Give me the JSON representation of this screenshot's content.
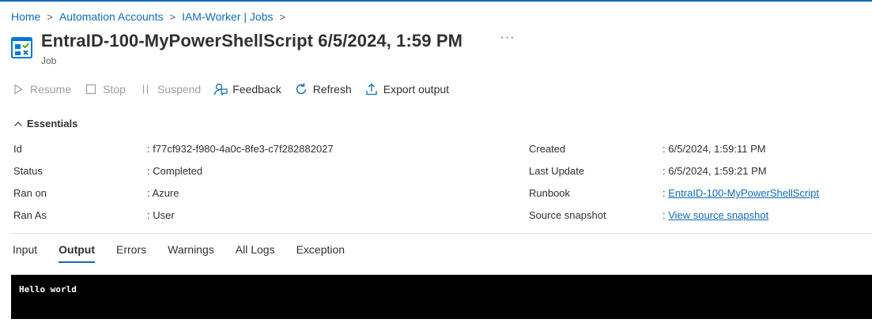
{
  "breadcrumb": {
    "items": [
      "Home",
      "Automation Accounts",
      "IAM-Worker | Jobs"
    ],
    "separator": ">"
  },
  "header": {
    "title": "EntraID-100-MyPowerShellScript 6/5/2024, 1:59 PM",
    "subtitle": "Job",
    "more": "···",
    "icon": "job-icon"
  },
  "toolbar": {
    "resume": "Resume",
    "stop": "Stop",
    "suspend": "Suspend",
    "feedback": "Feedback",
    "refresh": "Refresh",
    "export": "Export output"
  },
  "essentials": {
    "title": "Essentials",
    "colon": ":",
    "left": [
      {
        "label": "Id",
        "value": "f77cf932-f980-4a0c-8fe3-c7f282882027"
      },
      {
        "label": "Status",
        "value": "Completed"
      },
      {
        "label": "Ran on",
        "value": "Azure"
      },
      {
        "label": "Ran As",
        "value": "User"
      }
    ],
    "right": [
      {
        "label": "Created",
        "value": "6/5/2024, 1:59:11 PM"
      },
      {
        "label": "Last Update",
        "value": "6/5/2024, 1:59:21 PM"
      },
      {
        "label": "Runbook",
        "value": "EntraID-100-MyPowerShellScript"
      },
      {
        "label": "Source snapshot",
        "value": "View source snapshot"
      }
    ]
  },
  "tabs": [
    "Input",
    "Output",
    "Errors",
    "Warnings",
    "All Logs",
    "Exception"
  ],
  "active_tab": "Output",
  "output": {
    "text": "Hello world"
  },
  "colors": {
    "accent": "#0f6cbd",
    "text": "#323130",
    "disabled": "#a19f9d",
    "console_bg": "#000000",
    "console_fg": "#ffffff"
  }
}
